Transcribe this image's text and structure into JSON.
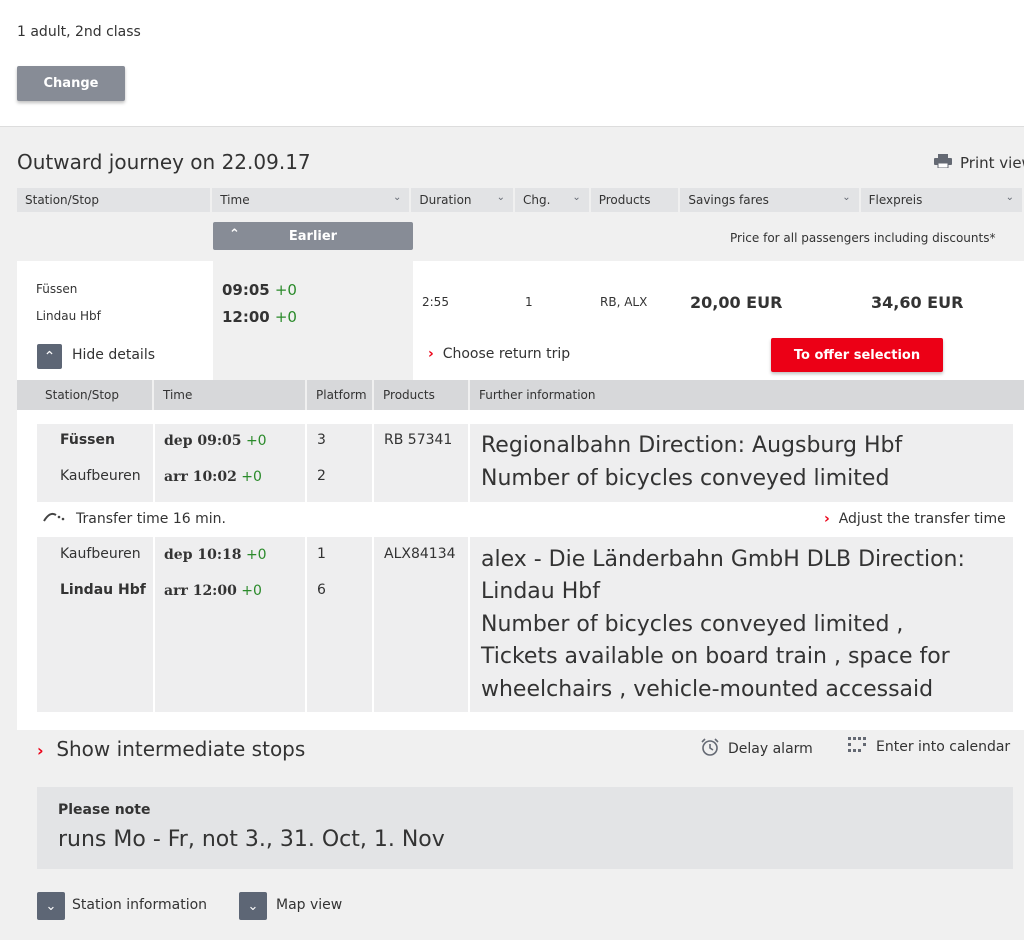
{
  "top": {
    "passengers": "1 adult, 2nd class",
    "change_label": "Change"
  },
  "journey": {
    "title": "Outward journey on 22.09.17",
    "print_label": "Print view",
    "columns": [
      "Station/Stop",
      "Time",
      "Duration",
      "Chg.",
      "Products",
      "Savings fares",
      "Flexpreis"
    ],
    "earlier_label": "Earlier",
    "price_note": "Price for all passengers including discounts*"
  },
  "connection": {
    "from": "Füssen",
    "to": "Lindau Hbf",
    "dep_time": "09:05",
    "dep_delay": "+0",
    "arr_time": "12:00",
    "arr_delay": "+0",
    "duration": "2:55",
    "changes": "1",
    "products": "RB, ALX",
    "savings_fare": "20,00 EUR",
    "flexpreis": "34,60 EUR",
    "hide_details_label": "Hide details",
    "choose_return_label": "Choose return trip",
    "offer_label": "To offer selection"
  },
  "details": {
    "columns": [
      "Station/Stop",
      "Time",
      "Platform",
      "Products",
      "Further information"
    ],
    "leg1": {
      "stop1": "Füssen",
      "time1_prefix": "dep 09:05",
      "time1_delay": "+0",
      "platform1": "3",
      "stop2": "Kaufbeuren",
      "time2_prefix": "arr 10:02",
      "time2_delay": "+0",
      "platform2": "2",
      "product": "RB 57341",
      "info_line1": "Regionalbahn Direction: Augsburg Hbf",
      "info_line2": "Number of bicycles conveyed limited"
    },
    "transfer_label": "Transfer time 16 min.",
    "adjust_transfer_label": "Adjust the transfer time",
    "leg2": {
      "stop1": "Kaufbeuren",
      "time1_prefix": "dep 10:18",
      "time1_delay": "+0",
      "platform1": "1",
      "stop2": "Lindau Hbf",
      "time2_prefix": "arr 12:00",
      "time2_delay": "+0",
      "platform2": "6",
      "product": "ALX84134",
      "info_line1": "alex - Die Länderbahn GmbH DLB Direction:",
      "info_line2": "Lindau Hbf",
      "info_line3": "Number of bicycles conveyed limited ,",
      "info_line4": "Tickets available on board train , space for",
      "info_line5": "wheelchairs , vehicle-mounted accessaid"
    },
    "show_stops_label": "Show intermediate stops",
    "delay_alarm_label": "Delay alarm",
    "calendar_label": "Enter into calendar",
    "note_title": "Please note",
    "note_text": "runs Mo - Fr, not 3., 31. Oct, 1. Nov",
    "station_info_label": "Station information",
    "map_view_label": "Map view"
  },
  "colors": {
    "accent_red": "#ec0016",
    "button_grey": "#878c96",
    "delay_green": "#2a8a2a"
  }
}
